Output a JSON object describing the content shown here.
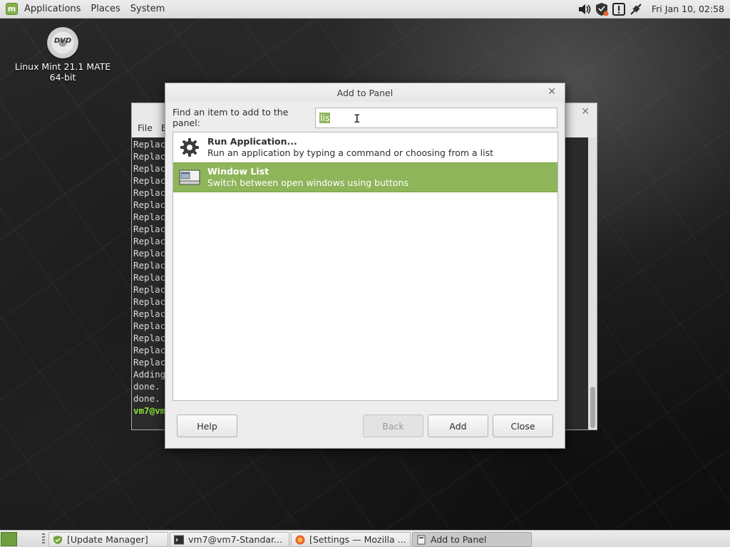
{
  "top_panel": {
    "menus": [
      "Applications",
      "Places",
      "System"
    ],
    "clock": "Fri Jan 10, 02:58",
    "tray_icons": [
      "volume-icon",
      "shield-update-icon",
      "notification-icon",
      "network-icon"
    ]
  },
  "desktop_icon": {
    "disc_text": "DVD",
    "label_line1": "Linux Mint 21.1 MATE",
    "label_line2": "64-bit"
  },
  "terminal": {
    "menus": [
      "File",
      "E"
    ],
    "lines": [
      "Replac",
      "Replac",
      "Replac",
      "Replac",
      "Replac",
      "Replac",
      "Replac",
      "Replac",
      "Replac",
      "Replac",
      "Replac",
      "Replac",
      "Replac",
      "Replac",
      "Replac",
      "Replac",
      "Replac",
      "Replac",
      "Replac",
      "Adding",
      "done.",
      "done."
    ],
    "prompt": "vm7@vm"
  },
  "dialog": {
    "title": "Add to Panel",
    "find_label": "Find an item to add to the panel:",
    "search_value": "lis",
    "items": [
      {
        "title": "Run Application...",
        "description": "Run an application by typing a command or choosing from a list",
        "icon": "gear-icon",
        "selected": false
      },
      {
        "title": "Window List",
        "description": "Switch between open windows using buttons",
        "icon": "window-list-icon",
        "selected": true
      }
    ],
    "buttons": {
      "help": "Help",
      "back": "Back",
      "add": "Add",
      "close": "Close"
    }
  },
  "taskbar": {
    "tasks": [
      {
        "label": "[Update Manager]",
        "icon": "update-manager-icon",
        "active": false
      },
      {
        "label": "vm7@vm7-Standar...",
        "icon": "terminal-icon",
        "active": false
      },
      {
        "label": "[Settings — Mozilla ...",
        "icon": "firefox-icon",
        "active": false
      },
      {
        "label": "Add to Panel",
        "icon": "panel-icon",
        "active": true
      }
    ]
  },
  "colors": {
    "accent": "#8fb55a",
    "prompt_green": "#8ae234"
  }
}
